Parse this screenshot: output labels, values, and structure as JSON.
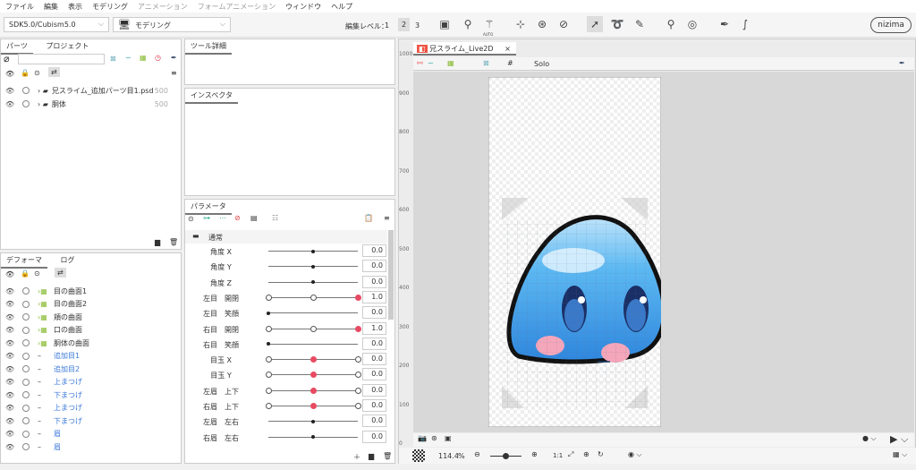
{
  "menu": [
    "ファイル",
    "編集",
    "表示",
    "モデリング",
    "アニメーション",
    "フォームアニメーション",
    "ウィンドウ",
    "ヘルプ"
  ],
  "menu_disabled": [
    false,
    false,
    false,
    false,
    true,
    true,
    false,
    false
  ],
  "toolbar": {
    "sdk": "SDK5.0/Cubism5.0",
    "mode": "モデリング",
    "edit_level_label": "編集レベル：",
    "levels": [
      "1",
      "2",
      "3"
    ],
    "active_level": "2",
    "logo": "nizima",
    "auto_label": "AUTO"
  },
  "parts_panel": {
    "tabs": [
      "パーツ",
      "プロジェクト"
    ],
    "search_placeholder": "",
    "items": [
      {
        "name": "兄スライム_追加パーツ目1.psd",
        "value": "500"
      },
      {
        "name": "胴体",
        "value": "500"
      }
    ]
  },
  "tool_detail": {
    "title": "ツール詳細"
  },
  "inspector": {
    "title": "インスペクタ"
  },
  "deformer_panel": {
    "tabs": [
      "デフォーマ",
      "ログ"
    ],
    "items": [
      {
        "name": "目の曲面1",
        "type": "warp"
      },
      {
        "name": "目の曲面2",
        "type": "warp"
      },
      {
        "name": "頬の曲面",
        "type": "warp"
      },
      {
        "name": "口の曲面",
        "type": "warp"
      },
      {
        "name": "胴体の曲面",
        "type": "warp"
      },
      {
        "name": "追加目1",
        "type": "mesh"
      },
      {
        "name": "追加目2",
        "type": "mesh"
      },
      {
        "name": "上まつげ",
        "type": "mesh"
      },
      {
        "name": "下まつげ",
        "type": "mesh"
      },
      {
        "name": "上まつげ",
        "type": "mesh"
      },
      {
        "name": "下まつげ",
        "type": "mesh"
      },
      {
        "name": "眉",
        "type": "mesh"
      },
      {
        "name": "眉",
        "type": "mesh"
      }
    ]
  },
  "parameters": {
    "title": "パラメータ",
    "group": "通常",
    "items": [
      {
        "name": "角度 X",
        "style": "dot",
        "pos": 0.5,
        "value": "0.0"
      },
      {
        "name": "角度 Y",
        "style": "dot",
        "pos": 0.5,
        "value": "0.0"
      },
      {
        "name": "角度 Z",
        "style": "dot",
        "pos": 0.5,
        "value": "0.0"
      },
      {
        "name": "左目　開閉",
        "style": "keys3",
        "pos": 1.0,
        "value": "1.0"
      },
      {
        "name": "左目　笑顔",
        "style": "dot",
        "pos": 0.0,
        "value": "0.0"
      },
      {
        "name": "右目　開閉",
        "style": "keys3",
        "pos": 1.0,
        "value": "1.0"
      },
      {
        "name": "右目　笑顔",
        "style": "dot",
        "pos": 0.0,
        "value": "0.0"
      },
      {
        "name": "目玉 X",
        "style": "keys3",
        "pos": 0.5,
        "value": "0.0"
      },
      {
        "name": "目玉 Y",
        "style": "keys3",
        "pos": 0.5,
        "value": "0.0"
      },
      {
        "name": "左眉　上下",
        "style": "keys3",
        "pos": 0.5,
        "value": "0.0"
      },
      {
        "name": "右眉　上下",
        "style": "keys3",
        "pos": 0.5,
        "value": "0.0"
      },
      {
        "name": "左眉　左右",
        "style": "dot",
        "pos": 0.5,
        "value": "0.0"
      },
      {
        "name": "右眉　左右",
        "style": "dot",
        "pos": 0.5,
        "value": "0.0"
      }
    ]
  },
  "viewport": {
    "tab": "兄スライム_Live2D",
    "solo": "Solo",
    "ruler": [
      "1000",
      "900",
      "800",
      "700",
      "600",
      "500",
      "400",
      "300",
      "200",
      "100",
      "0"
    ],
    "zoom": "114.4",
    "zoom_unit": "%",
    "zoom_slider": 0.5,
    "one_to_one": "1:1"
  },
  "colors": {
    "accent_red": "#e84a62",
    "slime_blue": "#3fa9ee",
    "link_blue": "#3a78d8"
  }
}
